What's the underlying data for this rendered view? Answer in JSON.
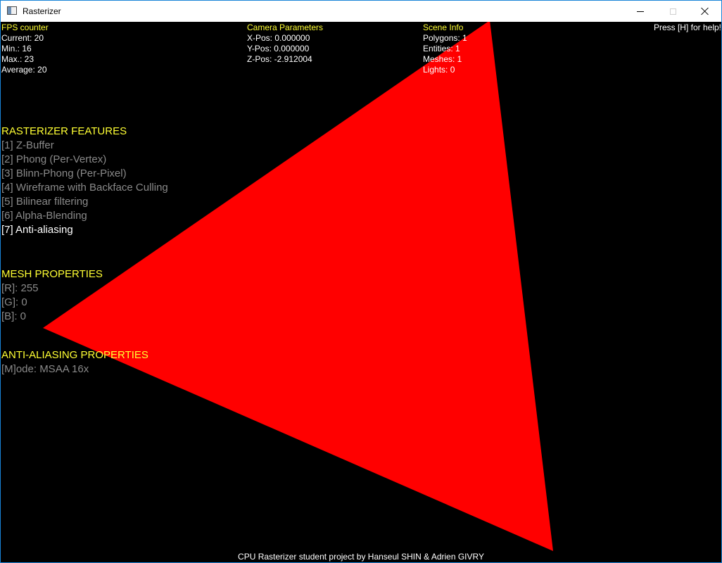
{
  "window": {
    "title": "Rasterizer"
  },
  "scene": {
    "triangle_color": "#ff0000",
    "background_color": "#000000"
  },
  "fps": {
    "heading": "FPS counter",
    "lines": [
      "Current: 20",
      "Min.: 16",
      "Max.: 23",
      "Average: 20"
    ]
  },
  "camera": {
    "heading": "Camera Parameters",
    "lines": [
      "X-Pos: 0.000000",
      "Y-Pos: 0.000000",
      "Z-Pos: -2.912004"
    ]
  },
  "scene_info": {
    "heading": "Scene Info",
    "lines": [
      "Polygons: 1",
      "Entities: 1",
      "Meshes: 1",
      "Lights: 0"
    ]
  },
  "help": "Press [H] for help!",
  "features": {
    "heading": "RASTERIZER FEATURES",
    "items": [
      {
        "label": "[1] Z-Buffer",
        "enabled": false
      },
      {
        "label": "[2] Phong (Per-Vertex)",
        "enabled": false
      },
      {
        "label": "[3] Blinn-Phong (Per-Pixel)",
        "enabled": false
      },
      {
        "label": "[4] Wireframe with Backface Culling",
        "enabled": false
      },
      {
        "label": "[5] Bilinear filtering",
        "enabled": false
      },
      {
        "label": "[6] Alpha-Blending",
        "enabled": false
      },
      {
        "label": "[7] Anti-aliasing",
        "enabled": true
      }
    ]
  },
  "mesh": {
    "heading": "MESH PROPERTIES",
    "items": [
      "[R]: 255",
      "[G]: 0",
      "[B]: 0"
    ]
  },
  "antialiasing": {
    "heading": "ANTI-ALIASING PROPERTIES",
    "items": [
      "[M]ode: MSAA 16x"
    ]
  },
  "footer": "CPU Rasterizer student project by Hanseul SHIN & Adrien GIVRY"
}
